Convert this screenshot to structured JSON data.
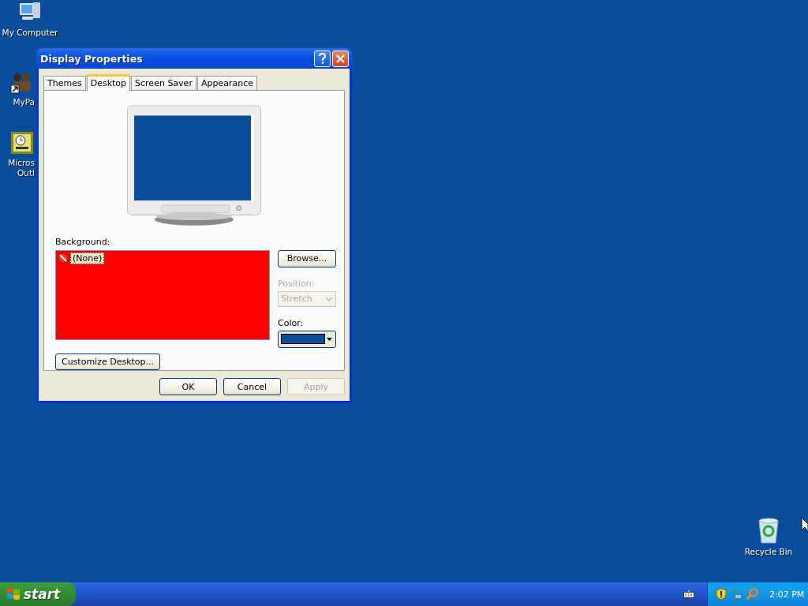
{
  "desktop_icons": [
    {
      "label": "My Computer",
      "kind": "computer"
    },
    {
      "label": "MyPa",
      "kind": "shortcut"
    },
    {
      "label": "Micros\nOutl",
      "kind": "clock"
    }
  ],
  "recycle_bin": {
    "label": "Recycle Bin"
  },
  "window": {
    "title": "Display Properties",
    "tabs": [
      {
        "label": "Themes",
        "selected": false
      },
      {
        "label": "Desktop",
        "selected": true
      },
      {
        "label": "Screen Saver",
        "selected": false
      },
      {
        "label": "Appearance",
        "selected": false
      }
    ],
    "background_label": "Background:",
    "background_items": [
      {
        "label": "(None)",
        "selected": true
      }
    ],
    "browse_button": "Browse...",
    "position": {
      "label": "Position:",
      "value": "Stretch",
      "disabled": true
    },
    "color": {
      "label": "Color:",
      "color": "#0b4e9b"
    },
    "customize_button": "Customize Desktop...",
    "buttons": [
      {
        "label": "OK",
        "disabled": false
      },
      {
        "label": "Cancel",
        "disabled": false
      },
      {
        "label": "Apply",
        "disabled": true
      }
    ]
  },
  "taskbar": {
    "start": "start",
    "clock": "2:02 PM"
  }
}
